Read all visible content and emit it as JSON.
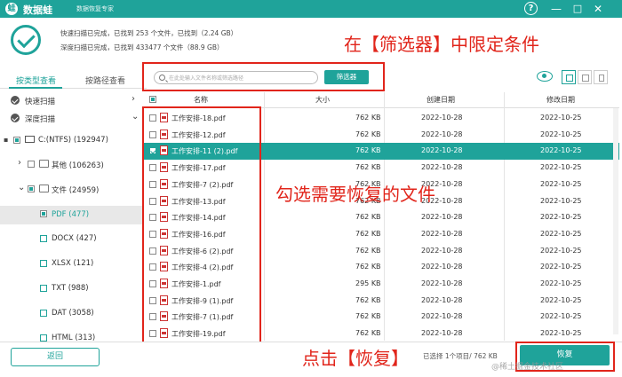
{
  "app": {
    "name": "数据蛙",
    "subtitle": "数据恢复专家",
    "logo_text": "蛙"
  },
  "window": {
    "help": "?",
    "minimize": "—",
    "maximize": "□",
    "close": "✕"
  },
  "status": {
    "quick_line": {
      "pre": "快速扫描已完成，已找到 ",
      "count": "253",
      "mid": " 个文件，已找到（",
      "size": "2.24 GB",
      "post": "）"
    },
    "deep_line": {
      "pre": "深度扫描已完成，已找到 ",
      "count": "433477",
      "mid": " 个文件（",
      "size": "88.9 GB",
      "post": "）"
    }
  },
  "annotations": {
    "filter": "在【筛选器】中限定条件",
    "select": "勾选需要恢复的文件",
    "click": "点击【恢复】"
  },
  "tabs": {
    "by_type": "按类型查看",
    "by_path": "按路径查看"
  },
  "search": {
    "placeholder": "在此处输入文件名称或筛选路径"
  },
  "filter_button": "筛选器",
  "sidebar": {
    "quick_scan": "快速扫描",
    "deep_scan": "深度扫描",
    "drive": "C:(NTFS) (192947)",
    "other": "其他 (106263)",
    "docs": "文件 (24959)",
    "types": [
      "PDF (477)",
      "DOCX (427)",
      "XLSX (121)",
      "TXT (988)",
      "DAT (3058)",
      "HTML (313)"
    ]
  },
  "table": {
    "headers": {
      "name": "名称",
      "size": "大小",
      "created": "创建日期",
      "modified": "修改日期"
    },
    "rows": [
      {
        "name": "工作安排-18.pdf",
        "size": "762 KB",
        "created": "2022-10-28",
        "modified": "2022-10-25",
        "checked": false
      },
      {
        "name": "工作安排-12.pdf",
        "size": "762 KB",
        "created": "2022-10-28",
        "modified": "2022-10-25",
        "checked": false
      },
      {
        "name": "工作安排-11 (2).pdf",
        "size": "762 KB",
        "created": "2022-10-28",
        "modified": "2022-10-25",
        "checked": true
      },
      {
        "name": "工作安排-17.pdf",
        "size": "762 KB",
        "created": "2022-10-28",
        "modified": "2022-10-25",
        "checked": false
      },
      {
        "name": "工作安排-7 (2).pdf",
        "size": "762 KB",
        "created": "2022-10-28",
        "modified": "2022-10-25",
        "checked": false
      },
      {
        "name": "工作安排-13.pdf",
        "size": "762 KB",
        "created": "2022-10-28",
        "modified": "2022-10-25",
        "checked": false
      },
      {
        "name": "工作安排-14.pdf",
        "size": "762 KB",
        "created": "2022-10-28",
        "modified": "2022-10-25",
        "checked": false
      },
      {
        "name": "工作安排-16.pdf",
        "size": "762 KB",
        "created": "2022-10-28",
        "modified": "2022-10-25",
        "checked": false
      },
      {
        "name": "工作安排-6 (2).pdf",
        "size": "762 KB",
        "created": "2022-10-28",
        "modified": "2022-10-25",
        "checked": false
      },
      {
        "name": "工作安排-4 (2).pdf",
        "size": "762 KB",
        "created": "2022-10-28",
        "modified": "2022-10-25",
        "checked": false
      },
      {
        "name": "工作安排-1.pdf",
        "size": "295 KB",
        "created": "2022-10-28",
        "modified": "2022-10-25",
        "checked": false
      },
      {
        "name": "工作安排-9 (1).pdf",
        "size": "762 KB",
        "created": "2022-10-28",
        "modified": "2022-10-25",
        "checked": false
      },
      {
        "name": "工作安排-7 (1).pdf",
        "size": "762 KB",
        "created": "2022-10-28",
        "modified": "2022-10-25",
        "checked": false
      },
      {
        "name": "工作安排-19.pdf",
        "size": "762 KB",
        "created": "2022-10-28",
        "modified": "2022-10-25",
        "checked": false
      }
    ]
  },
  "footer": {
    "back": "返回",
    "selected_info": "已选择 1个项目/ 762 KB",
    "recover": "恢复",
    "watermark": "@稀土掘金技术社区"
  },
  "colors": {
    "accent": "#1fa39a",
    "annotation": "#e1251b"
  }
}
